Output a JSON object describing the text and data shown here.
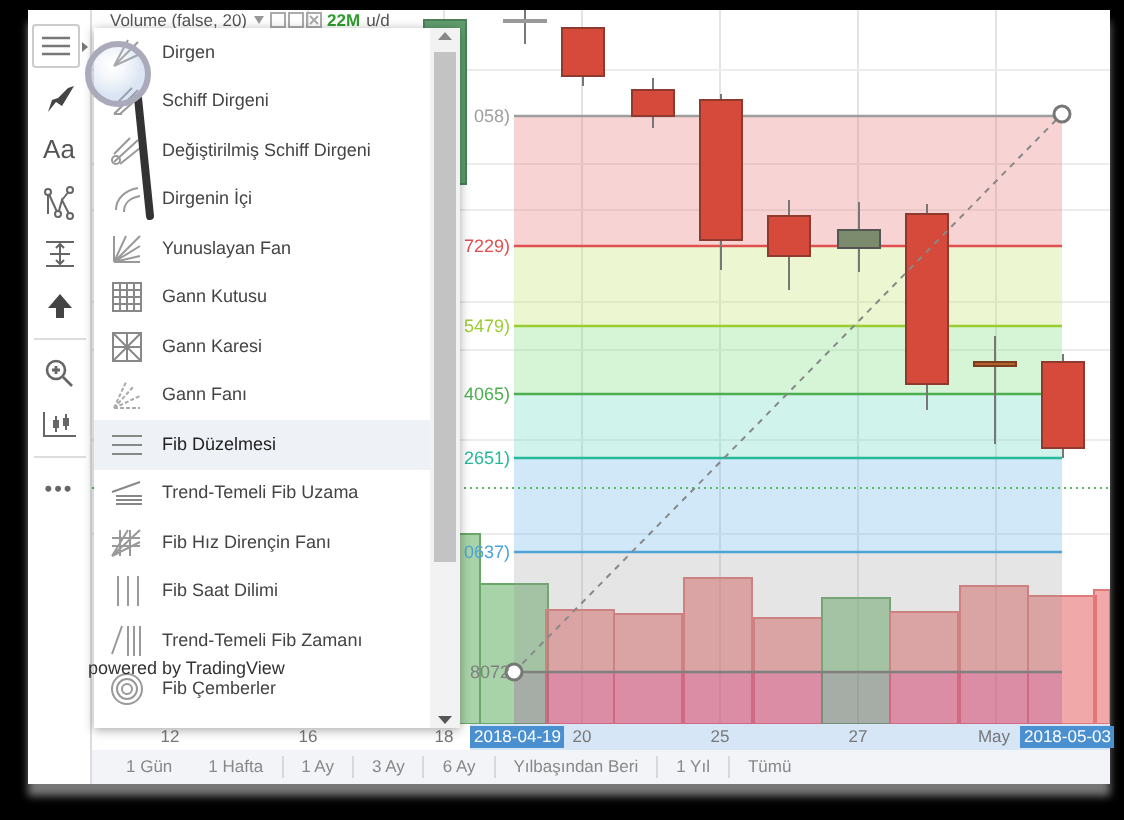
{
  "toolbar": {
    "text_tool": "Aa",
    "more": "•••"
  },
  "legend": {
    "title": "Volume (false, 20)",
    "value": "22M",
    "unit": "u/d"
  },
  "drawing_menu": {
    "items": [
      {
        "label": "Dirgen",
        "selected": false
      },
      {
        "label": "Schiff Dirgeni",
        "selected": false
      },
      {
        "label": "Değiştirilmiş Schiff Dirgeni",
        "selected": false
      },
      {
        "label": "Dirgenin İçi",
        "selected": false
      },
      {
        "label": "Yunuslayan Fan",
        "selected": false
      },
      {
        "label": "Gann Kutusu",
        "selected": false
      },
      {
        "label": "Gann Karesi",
        "selected": false
      },
      {
        "label": "Gann Fanı",
        "selected": false
      },
      {
        "label": "Fib Düzelmesi",
        "selected": true
      },
      {
        "label": "Trend-Temeli Fib Uzama",
        "selected": false
      },
      {
        "label": "Fib Hız Dirençin Fanı",
        "selected": false
      },
      {
        "label": "Fib Saat Dilimi",
        "selected": false
      },
      {
        "label": "Trend-Temeli Fib Zamanı",
        "selected": false
      },
      {
        "label": "Fib Çemberler",
        "selected": false
      }
    ]
  },
  "chart": {
    "fib_levels": [
      {
        "label": "058)",
        "color": "#9e9e9e"
      },
      {
        "label": "7229)",
        "color": "#e05050"
      },
      {
        "label": "5479)",
        "color": "#9acd32"
      },
      {
        "label": "4065)",
        "color": "#4caf50"
      },
      {
        "label": "2651)",
        "color": "#26b99a"
      },
      {
        "label": "0637)",
        "color": "#4fa3d6"
      },
      {
        "label": "8072",
        "color": "#808080"
      }
    ],
    "attribution": "powered by TradingView"
  },
  "x_axis": {
    "labels": [
      {
        "text": "12",
        "highlighted": false
      },
      {
        "text": "16",
        "highlighted": false
      },
      {
        "text": "18",
        "highlighted": false
      },
      {
        "text": "2018-04-19",
        "highlighted": true
      },
      {
        "text": "20",
        "highlighted": false
      },
      {
        "text": "25",
        "highlighted": false
      },
      {
        "text": "27",
        "highlighted": false
      },
      {
        "text": "May",
        "highlighted": false
      },
      {
        "text": "2018-05-03",
        "highlighted": true
      }
    ]
  },
  "range_buttons": [
    "1 Gün",
    "1 Hafta",
    "1 Ay",
    "3 Ay",
    "6 Ay",
    "Yılbaşından Beri",
    "1 Yıl",
    "Tümü"
  ]
}
